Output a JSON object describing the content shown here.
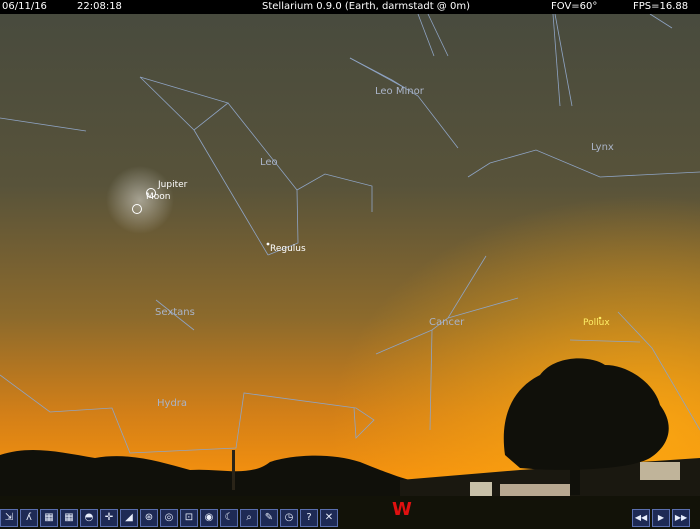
{
  "status_bar": {
    "date": "06/11/16",
    "time": "22:08:18",
    "title": "Stellarium 0.9.0 (Earth, darmstadt @ 0m)",
    "fov": "FOV=60°",
    "fps": "FPS=16.88"
  },
  "constellations": {
    "leo_minor": "Leo Minor",
    "lynx": "Lynx",
    "leo": "Leo",
    "sextans": "Sextans",
    "cancer": "Cancer",
    "hydra": "Hydra"
  },
  "objects": {
    "jupiter": "Jupiter",
    "moon": "Moon",
    "regulus": "Regulus",
    "pollux": "Pollux"
  },
  "cardinal": "W",
  "toolbar_icons": [
    "constellation-lines-icon",
    "constellation-art-icon",
    "equatorial-grid-icon",
    "azimuthal-grid-icon",
    "ground-icon",
    "cardinal-points-icon",
    "atmosphere-icon",
    "nebulae-icon",
    "planet-labels-icon",
    "mount-icon",
    "center-object-icon",
    "night-mode-icon",
    "search-icon",
    "configuration-icon",
    "sky-view-icon",
    "help-icon",
    "quit-icon"
  ],
  "toolbar_glyphs": [
    "⇲",
    "ʎ",
    "▦",
    "▦",
    "◓",
    "✛",
    "◢",
    "⊛",
    "◎",
    "⊡",
    "◉",
    "☾",
    "⌕",
    "✎",
    "◷",
    "?",
    "✕"
  ],
  "time_controls": [
    "◀◀",
    "▶",
    "▶▶"
  ],
  "colors": {
    "sky_top": "#4a4d3e",
    "sky_horizon": "#f08a10",
    "constellation_line": "#8fa4c4",
    "cardinal": "#e01010"
  }
}
